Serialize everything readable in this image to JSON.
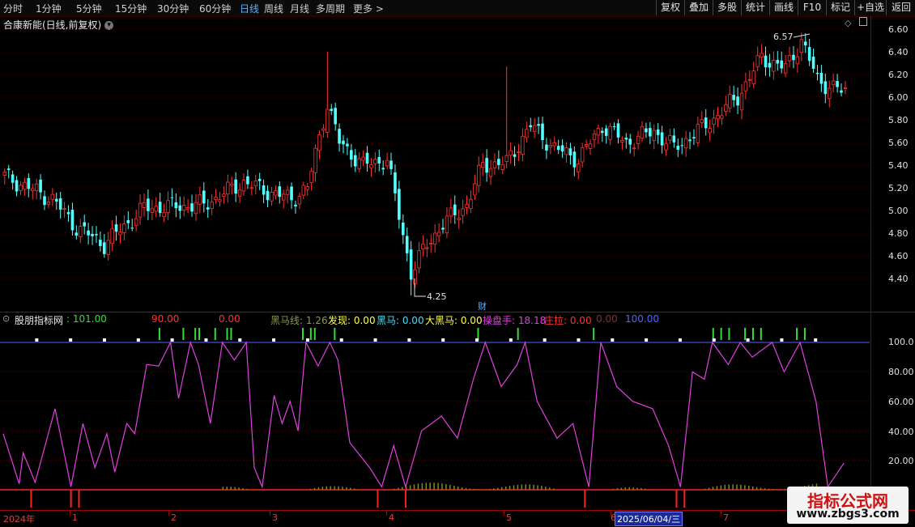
{
  "toolbar": {
    "timeframes": [
      "分时",
      "1分钟",
      "5分钟",
      "15分钟",
      "30分钟",
      "60分钟",
      "日线",
      "周线",
      "月线",
      "多周期",
      "更多 >"
    ],
    "active": "日线",
    "buttons": [
      "复权",
      "叠加",
      "多股",
      "统计",
      "画线",
      "F10",
      "标记",
      "+自选",
      "返回"
    ]
  },
  "stock": {
    "title": "合康新能(日线,前复权)",
    "circle_icon": "chevron-down-icon"
  },
  "price_axis": {
    "labels": [
      "6.60",
      "6.40",
      "6.20",
      "6.00",
      "5.80",
      "5.60",
      "5.40",
      "5.20",
      "5.00",
      "4.80",
      "4.60",
      "4.40"
    ],
    "min": 4.25,
    "max": 6.57
  },
  "annotations": {
    "high": "6.57",
    "low": "4.25",
    "cai": "财"
  },
  "indicator": {
    "name": "股朋指标网",
    "value": ": 101.00",
    "v2": "90.00",
    "v3": "0.00",
    "l1": "黑马线: 1.26",
    "l2": "发现: 0.00",
    "l3": "黑马: 0.00",
    "l4": "大黑马: 0.00",
    "l5": "操盘手: 18.18",
    "l6": "庄拉: 0.00",
    "v7": "0.00",
    "v8": "100.00",
    "axis": [
      "100.0",
      "80.00",
      "60.00",
      "40.00",
      "20.00"
    ]
  },
  "xaxis": {
    "labels": [
      "2024年",
      "1",
      "2",
      "3",
      "4",
      "5",
      "6",
      "7"
    ],
    "date_box": "2025/06/04/三"
  },
  "watermark": {
    "line1": "指标公式网",
    "line2": "www.zbgs3.com"
  },
  "colors": {
    "up": "#ff3232",
    "down": "#54ffff",
    "line": "#e040e0",
    "ref": "#5064ff",
    "green": "#30e030"
  },
  "chart_data": {
    "type": "candlestick",
    "title": "合康新能(日线,前复权)",
    "ylim": [
      4.25,
      6.57
    ],
    "keypoints": [
      [
        0,
        5.3
      ],
      [
        12,
        5.1
      ],
      [
        18,
        4.85
      ],
      [
        25,
        4.7
      ],
      [
        35,
        5.02
      ],
      [
        50,
        5.05
      ],
      [
        60,
        5.25
      ],
      [
        65,
        5.18
      ],
      [
        72,
        5.1
      ],
      [
        76,
        5.2
      ],
      [
        81,
        5.95
      ],
      [
        84,
        5.6
      ],
      [
        90,
        5.4
      ],
      [
        96,
        5.45
      ],
      [
        102,
        4.45
      ],
      [
        106,
        4.7
      ],
      [
        110,
        4.88
      ],
      [
        116,
        5.05
      ],
      [
        120,
        5.4
      ],
      [
        126,
        5.42
      ],
      [
        132,
        5.75
      ],
      [
        138,
        5.55
      ],
      [
        144,
        5.45
      ],
      [
        150,
        5.75
      ],
      [
        156,
        5.6
      ],
      [
        163,
        5.7
      ],
      [
        168,
        5.55
      ],
      [
        176,
        5.75
      ],
      [
        184,
        6.0
      ],
      [
        190,
        6.35
      ],
      [
        196,
        6.25
      ],
      [
        200,
        6.5
      ],
      [
        204,
        6.15
      ],
      [
        210,
        6.05
      ]
    ],
    "indicator_axis": [
      0,
      100
    ]
  }
}
